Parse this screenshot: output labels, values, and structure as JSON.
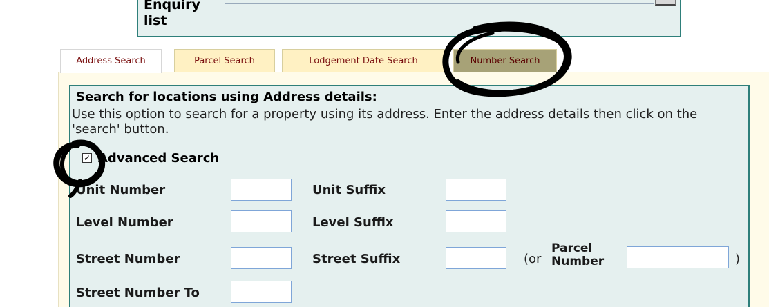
{
  "enquiry": {
    "label": "Enquiry list"
  },
  "tabs": [
    {
      "label": "Address Search",
      "active": true
    },
    {
      "label": "Parcel Search",
      "active": false
    },
    {
      "label": "Lodgement Date Search",
      "active": false
    },
    {
      "label": "Number Search",
      "active": false
    }
  ],
  "search": {
    "heading": "Search for locations using Address details:",
    "description": "Use this option to search for a property using its address. Enter the address details then click on the 'search' button.",
    "advanced_label": "Advanced Search",
    "advanced_checked": true,
    "checkbox_mark": "✓"
  },
  "fields": {
    "unit_number": "Unit Number",
    "unit_suffix": "Unit Suffix",
    "level_number": "Level Number",
    "level_suffix": "Level Suffix",
    "street_number": "Street Number",
    "street_suffix": "Street Suffix",
    "street_number_to": "Street Number To",
    "parcel_number": "Parcel Number",
    "or_open": "(or",
    "close_paren": ")"
  },
  "colors": {
    "section_bg": "#e5f0ef",
    "section_border": "#2e7f7a",
    "tab_text": "#7a0f0f",
    "input_border": "#7fa6d8"
  }
}
